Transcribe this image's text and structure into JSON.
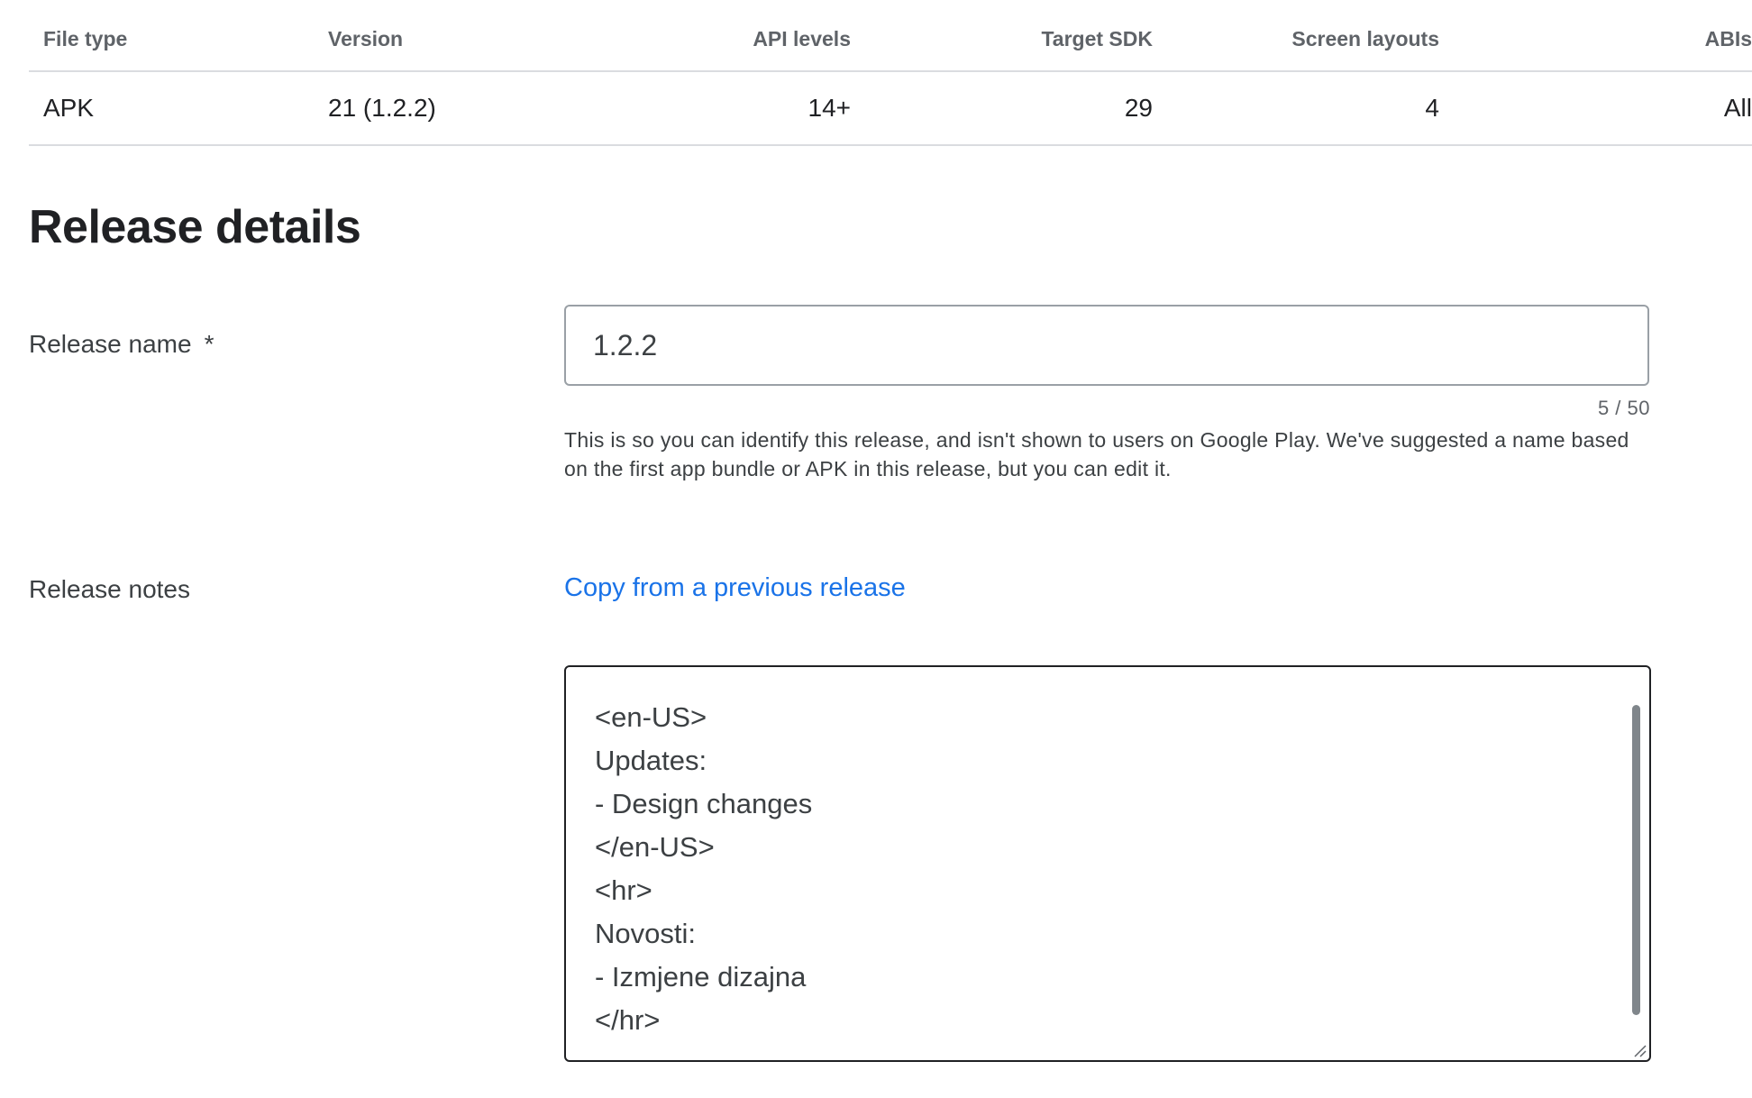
{
  "table": {
    "headers": {
      "file_type": "File type",
      "version": "Version",
      "api_levels": "API levels",
      "target_sdk": "Target SDK",
      "screen_layouts": "Screen layouts",
      "abis": "ABIs"
    },
    "rows": [
      {
        "file_type": "APK",
        "version": "21 (1.2.2)",
        "api_levels": "14+",
        "target_sdk": "29",
        "screen_layouts": "4",
        "abis": "All"
      }
    ]
  },
  "release_details": {
    "title": "Release details",
    "release_name": {
      "label": "Release name",
      "required_marker": "*",
      "value": "1.2.2",
      "counter": "5 / 50",
      "helper": "This is so you can identify this release, and isn't shown to users on Google Play. We've suggested a name based on the first app bundle or APK in this release, but you can edit it."
    },
    "release_notes": {
      "label": "Release notes",
      "copy_link": "Copy from a previous release",
      "lines": [
        "<en-US>",
        "Updates:",
        "- Design changes",
        "</en-US>",
        "<hr>",
        "Novosti:",
        "- Izmjene dizajna",
        "</hr>"
      ]
    }
  },
  "colors": {
    "link": "#1a73e8",
    "border_focus": "#202124",
    "border_default": "#9aa0a6",
    "muted_text": "#5f6368"
  }
}
